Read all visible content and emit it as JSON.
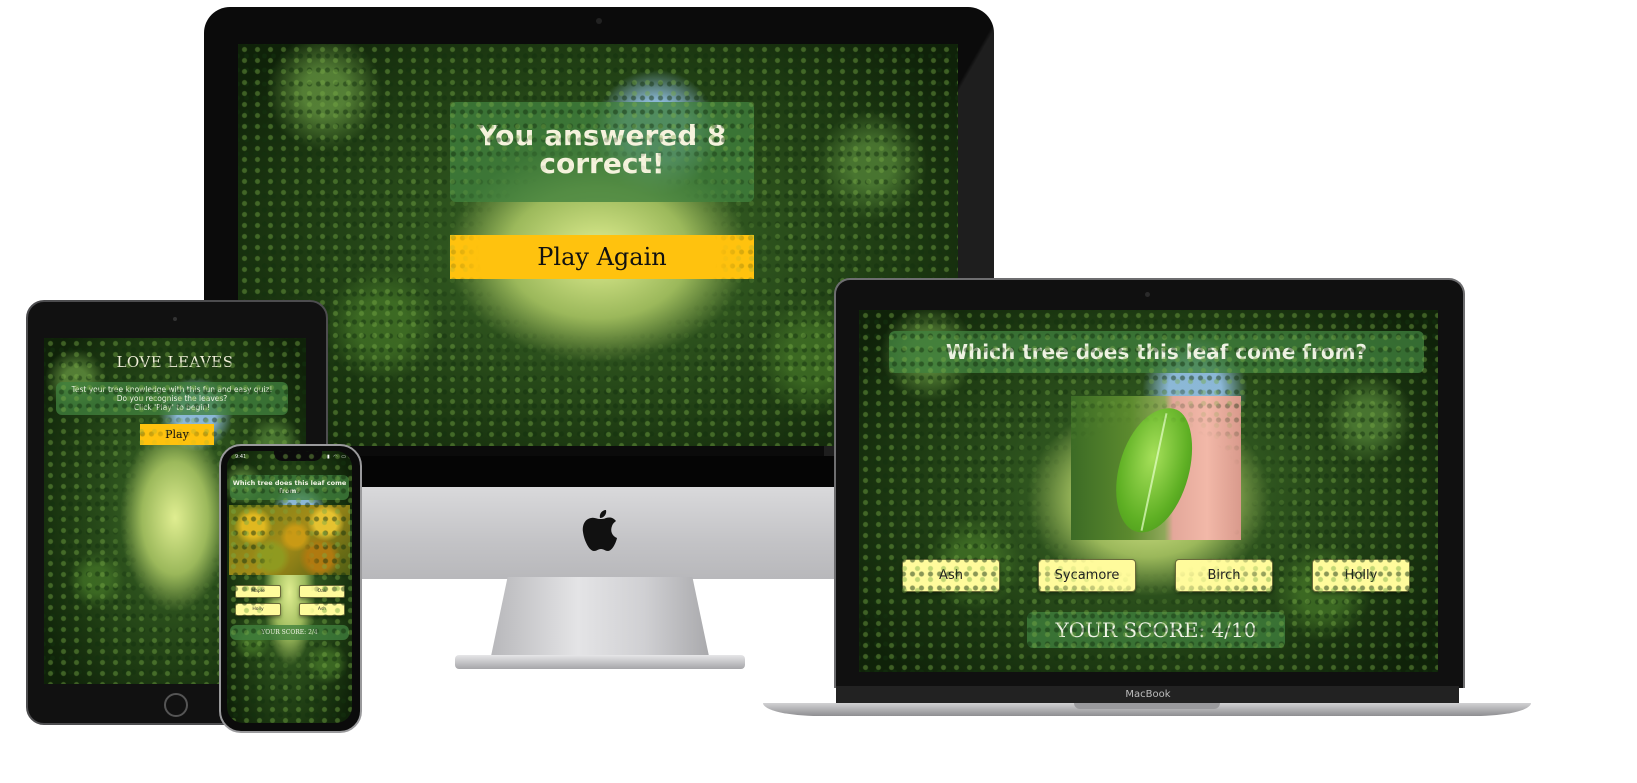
{
  "desktop": {
    "result_text": "You answered 8 correct!",
    "play_again_label": "Play Again"
  },
  "laptop": {
    "question": "Which tree does this leaf come from?",
    "answers": [
      "Ash",
      "Sycamore",
      "Birch",
      "Holly"
    ],
    "score": "YOUR SCORE: 4/10",
    "brand_label": "MacBook"
  },
  "tablet": {
    "title": "LOVE LEAVES",
    "intro_line1": "Test your tree knowledge with this fun and easy quiz!",
    "intro_line2": "Do you recognise the leaves?",
    "intro_line3": "Click 'Play' to begin!",
    "play_label": "Play"
  },
  "phone": {
    "time": "9:41",
    "question": "Which tree does this leaf come from?",
    "answers": [
      "Maple",
      "Oak",
      "Holly",
      "Ash"
    ],
    "score": "YOUR SCORE: 2/4"
  },
  "colors": {
    "panel_green": "#40803e",
    "play_yellow": "#ffc20e",
    "answer_yellow": "#fffb9c"
  }
}
